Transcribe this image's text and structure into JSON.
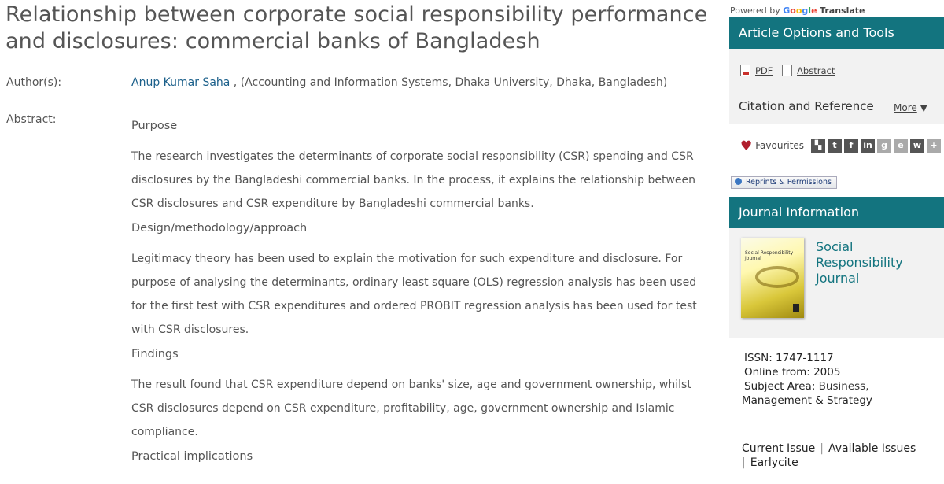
{
  "article": {
    "title": "Relationship between corporate social responsibility performance and disclosures: commercial banks of Bangladesh",
    "authors_label": "Author(s):",
    "author_name": "Anup Kumar Saha",
    "author_affiliation": " , (Accounting and Information Systems, Dhaka University, Dhaka, Bangladesh)",
    "abstract_label": "Abstract:",
    "abstract": {
      "purpose_heading": "Purpose",
      "purpose_text": "The research investigates the determinants of corporate social responsibility (CSR) spending and CSR disclosures by the Bangladeshi commercial banks. In the process, it explains the relationship between CSR disclosures and CSR expenditure by Bangladeshi commercial banks.",
      "design_heading": "Design/methodology/approach",
      "design_text": "Legitimacy theory has been used to explain the motivation for such expenditure and disclosure. For purpose of analysing the determinants, ordinary least square (OLS) regression analysis has been used for the first test with CSR expenditures and ordered PROBIT regression analysis has been used for test with CSR disclosures.",
      "findings_heading": "Findings",
      "findings_text": "The result found that CSR expenditure depend on banks' size, age and government ownership, whilst CSR disclosures depend on CSR expenditure, profitability, age, government ownership and Islamic compliance.",
      "implications_heading": "Practical implications"
    }
  },
  "sidebar": {
    "translate": {
      "powered_by": "Powered by",
      "google": "Google",
      "translate": "Translate"
    },
    "options_title": "Article Options and Tools",
    "pdf_label": "PDF",
    "abstract_link": "Abstract",
    "citation_title": "Citation and Reference",
    "more_label": "More",
    "favourites_label": "Favourites",
    "share_icons": [
      "delicious-icon",
      "twitter-icon",
      "facebook-icon",
      "linkedin-icon",
      "google-icon",
      "evernote-icon",
      "weibo-icon",
      "add-more-icon"
    ],
    "reprints_label": "Reprints & Permissions",
    "journal_info_title": "Journal Information",
    "journal_name": "Social Responsibility Journal",
    "cover_text": "Social Responsibility Journal",
    "issn": "ISSN: 1747-1117",
    "online_from": "Online from: 2005",
    "subject_area_label": "Subject Area:",
    "subject_area_value": "Business,",
    "subject_area_value2": "Management & Strategy",
    "current_issue": "Current Issue",
    "available_issues": "Available Issues",
    "earlycite": "Earlycite",
    "colors": {
      "teal": "#13747f",
      "panel_bg": "#f2f2f2",
      "heart": "#b11f2e"
    }
  }
}
